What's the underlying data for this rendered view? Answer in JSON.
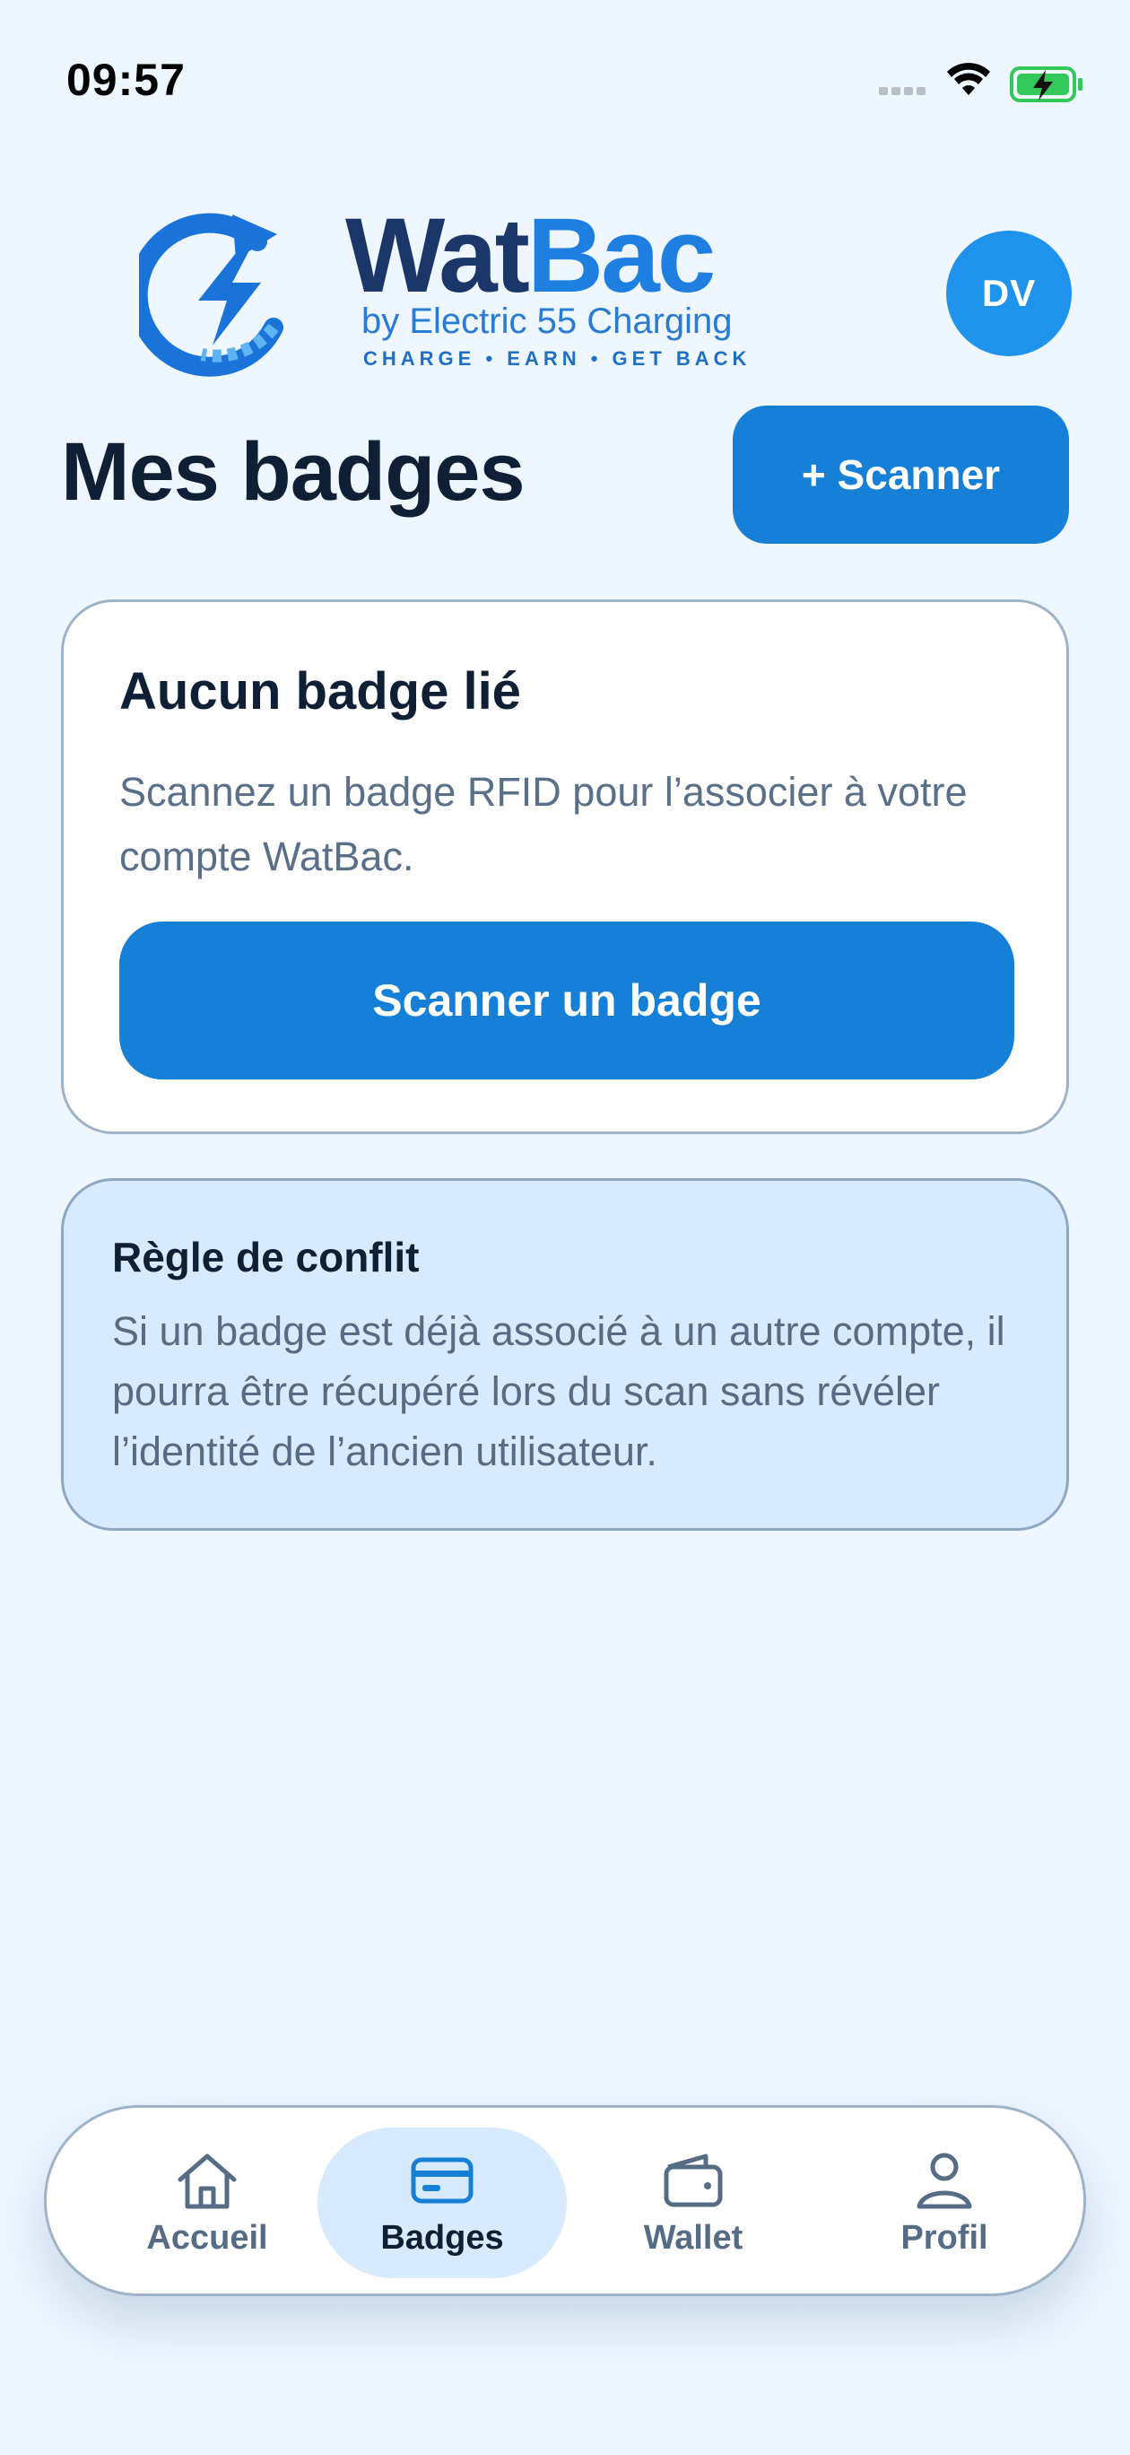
{
  "status_bar": {
    "time": "09:57"
  },
  "header": {
    "brand_name": "WatBac",
    "brand_subtitle": "by Electric 55 Charging",
    "brand_tagline": "CHARGE • EARN • GET BACK",
    "avatar_initials": "DV",
    "page_title": "Mes badges",
    "scan_button_label": "+ Scanner"
  },
  "empty_card": {
    "title": "Aucun badge lié",
    "text": "Scannez un badge RFID pour l’associer à votre compte WatBac.",
    "button_label": "Scanner un badge"
  },
  "info_box": {
    "title": "Règle de conflit",
    "text": "Si un badge est déjà associé à un autre compte, il pourra être récupéré lors du scan sans révéler l’identité de l’ancien utilisateur."
  },
  "bottom_nav": {
    "items": [
      {
        "label": "Accueil",
        "icon": "home-icon",
        "active": false
      },
      {
        "label": "Badges",
        "icon": "card-icon",
        "active": true
      },
      {
        "label": "Wallet",
        "icon": "wallet-icon",
        "active": false
      },
      {
        "label": "Profil",
        "icon": "user-icon",
        "active": false
      }
    ]
  },
  "colors": {
    "background": "#eef6ff",
    "primary": "#1680d6",
    "avatar": "#1f93ec",
    "info_background": "#d8eafd",
    "text_dark": "#0f1f36",
    "text_muted": "#566c85",
    "battery_green": "#34c759"
  }
}
